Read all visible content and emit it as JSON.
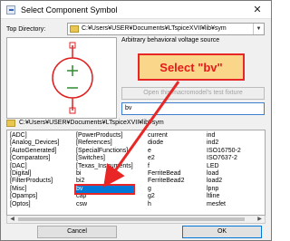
{
  "window": {
    "title": "Select Component Symbol",
    "close_glyph": "✕",
    "icon": "component-app-icon"
  },
  "top_directory": {
    "label": "Top Directory:",
    "value": "C:¥Users¥USER¥Documents¥LTspiceXVII¥lib¥sym"
  },
  "description": "Arbitrary behavioral voltage source",
  "callout": {
    "text": "Select \"bv\"",
    "fill": "#fad68a",
    "border": "#e82626",
    "text_color": "#e41b1b"
  },
  "open_button": {
    "label": "Open this macromodel's test fixture"
  },
  "search": {
    "value": "bv"
  },
  "current_path": "C:¥Users¥USER¥Documents¥LTspiceXVII¥lib¥sym",
  "list": {
    "columns": [
      [
        "[ADC]",
        "[Analog_Devices]",
        "[AutoGenerated]",
        "[Comparators]",
        "[DAC]",
        "[Digital]",
        "[FilterProducts]",
        "[Misc]",
        "[Opamps]",
        "[Optos]"
      ],
      [
        "[PowerProducts]",
        "[References]",
        "[SpecialFunctions]",
        "[Switches]",
        "[Texas_Instruments]",
        "bi",
        "bi2",
        "bv",
        "cap",
        "csw"
      ],
      [
        "current",
        "diode",
        "e",
        "e2",
        "f",
        "FerriteBead",
        "FerriteBead2",
        "g",
        "g2",
        "h"
      ],
      [
        "ind",
        "ind2",
        "ISO16750-2",
        "ISO7637-2",
        "LED",
        "load",
        "load2",
        "lpnp",
        "ltline",
        "mesfet"
      ]
    ],
    "selected": "bv"
  },
  "buttons": {
    "cancel": "Cancel",
    "ok": "OK"
  },
  "colors": {
    "selection": "#0078d7",
    "symbol_stroke": "#e02020",
    "symbol_plus": "#2e8b2e",
    "highlight": "#e82626"
  }
}
